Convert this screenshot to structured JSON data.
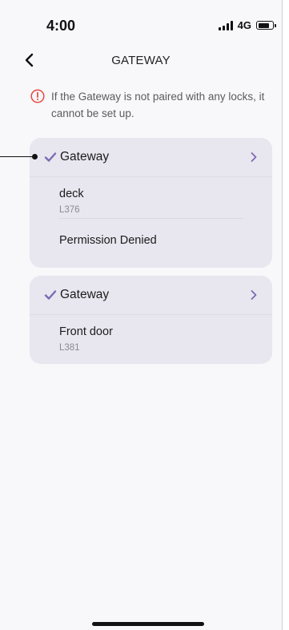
{
  "status": {
    "time": "4:00",
    "network": "4G",
    "battery_level": 0.7
  },
  "nav": {
    "title": "GATEWAY",
    "back_icon": "chevron-left-icon"
  },
  "notice": {
    "text": "If the Gateway is not paired with any locks, it cannot be set up.",
    "icon": "alert-circle-icon",
    "color": "#e5483d"
  },
  "gateways": [
    {
      "title": "Gateway",
      "locks": [
        {
          "name": "deck",
          "id": "L376"
        }
      ],
      "extra": "Permission Denied"
    },
    {
      "title": "Gateway",
      "locks": [
        {
          "name": "Front door",
          "id": "L381"
        }
      ]
    }
  ],
  "colors": {
    "accent": "#7b6bb5",
    "card": "#e8e6ee",
    "background": "#f8f7fa"
  }
}
